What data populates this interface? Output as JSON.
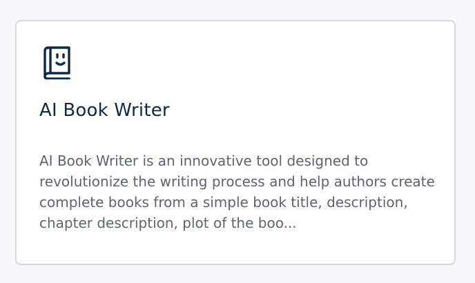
{
  "card": {
    "icon": "book-smiley-icon",
    "title": "AI Book Writer",
    "description": "AI Book Writer is an innovative tool designed to revolutionize the writing process and help authors create complete books from a simple book title, description, chapter description, plot of the boo..."
  },
  "colors": {
    "background": "#f7f8fa",
    "card_background": "#ffffff",
    "card_border": "#d5d8dc",
    "title": "#102a43",
    "description": "#5b6470",
    "icon": "#102a43"
  }
}
